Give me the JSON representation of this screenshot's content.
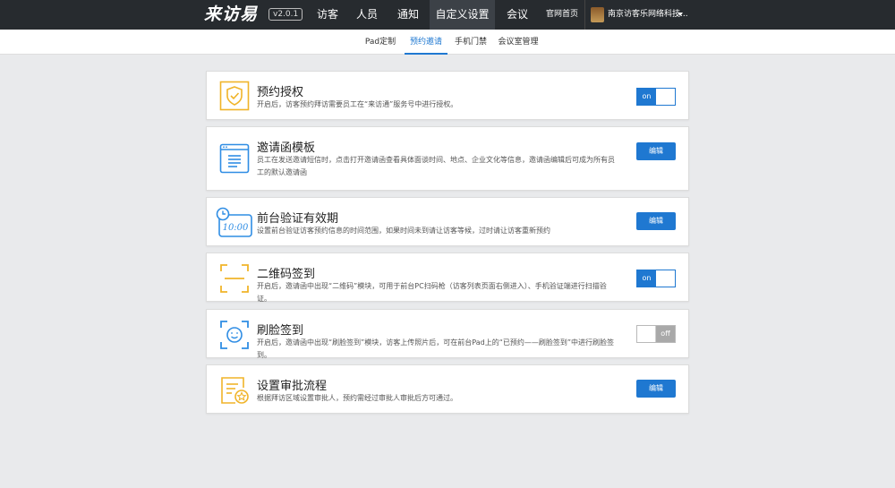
{
  "topbar": {
    "logo": "来访易",
    "version": "v2.0.1",
    "nav": [
      {
        "label": "访客"
      },
      {
        "label": "人员"
      },
      {
        "label": "通知"
      },
      {
        "label": "自定义设置"
      },
      {
        "label": "会议"
      }
    ],
    "home_link": "官网首页",
    "company": "南京访客乐网络科技...",
    "colors": {
      "bar": "#272b2f",
      "active": "#3c4147"
    }
  },
  "subtabs": [
    {
      "label": "Pad定制"
    },
    {
      "label": "预约邀请"
    },
    {
      "label": "手机门禁"
    },
    {
      "label": "会议室管理"
    }
  ],
  "accent": "#1f78d1",
  "cards": [
    {
      "title": "预约授权",
      "desc": "开启后，访客预约拜访需要员工在“来访通”服务号中进行授权。",
      "icon": "shield-check-icon",
      "control": "on"
    },
    {
      "title": "邀请函模板",
      "desc": "员工在发送邀请短信时，点击打开邀请函查看具体面谈时间、地点、企业文化等信息，邀请函编辑后可成为所有员工的默认邀请函",
      "icon": "document-window-icon",
      "control": "编辑"
    },
    {
      "title": "前台验证有效期",
      "desc": "设置前台验证访客预约信息的时间范围，如果时间未到请让访客等候，过时请让访客重新预约",
      "icon": "clock-display-icon",
      "clock_text": "10:00",
      "control": "编辑"
    },
    {
      "title": "二维码签到",
      "desc": "开启后，邀请函中出现“二维码”模块，可用于前台PC扫码枪（访客列表页面右侧进入）、手机验证端进行扫描验证。",
      "icon": "qr-scan-frame-icon",
      "control": "on"
    },
    {
      "title": "刷脸签到",
      "desc": "开启后，邀请函中出现“刷脸签到”模块，访客上传照片后，可在前台Pad上的“已预约——刷脸签到”中进行刷脸签到。",
      "icon": "face-scan-icon",
      "control": "off"
    },
    {
      "title": "设置审批流程",
      "desc": "根据拜访区域设置审批人，预约需经过审批人审批后方可通过。",
      "icon": "approval-list-icon",
      "control": "编辑"
    }
  ]
}
